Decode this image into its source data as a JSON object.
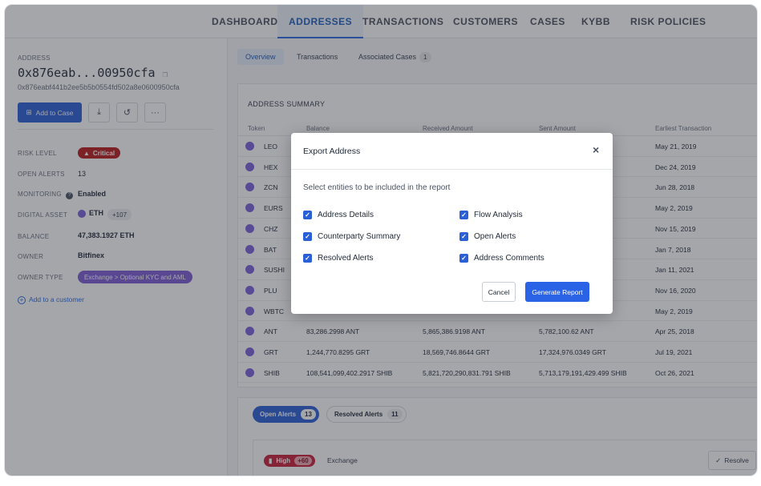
{
  "nav": {
    "items": [
      {
        "label": "DASHBOARD",
        "active": false
      },
      {
        "label": "ADDRESSES",
        "active": true
      },
      {
        "label": "TRANSACTIONS",
        "active": false
      },
      {
        "label": "CUSTOMERS",
        "active": false
      },
      {
        "label": "CASES",
        "active": false
      },
      {
        "label": "KYBB",
        "active": false
      },
      {
        "label": "RISK POLICIES",
        "active": false
      }
    ]
  },
  "address": {
    "section_label": "ADDRESS",
    "short_hash": "0x876eab...00950cfa",
    "full_hash": "0x876eabf441b2ee5b5b0554fd502a8e0600950cfa",
    "add_to_case_label": "Add to Case",
    "actions": {
      "download_icon": "download-icon",
      "history_icon": "history-icon",
      "more_label": "···"
    }
  },
  "details": {
    "risk_level_label": "RISK LEVEL",
    "risk_level_value": "Critical",
    "open_alerts_label": "OPEN ALERTS",
    "open_alerts_value": "13",
    "monitoring_label": "MONITORING",
    "monitoring_value": "Enabled",
    "digital_asset_label": "DIGITAL ASSET",
    "digital_asset_value": "ETH",
    "digital_asset_extra": "+107",
    "balance_label": "BALANCE",
    "balance_value": "47,383.1927 ETH",
    "owner_label": "OWNER",
    "owner_value": "Bitfinex",
    "owner_type_label": "OWNER TYPE",
    "owner_type_value": "Exchange > Optional KYC and AML",
    "add_customer_label": "Add to a customer"
  },
  "subtabs": [
    {
      "label": "Overview",
      "active": true
    },
    {
      "label": "Transactions",
      "active": false
    },
    {
      "label": "Associated Cases",
      "count": "1",
      "active": false
    }
  ],
  "summary": {
    "title": "ADDRESS SUMMARY",
    "columns": [
      "Token",
      "Balance",
      "Received Amount",
      "Sent Amount",
      "Earliest Transaction"
    ],
    "rows": [
      {
        "token": "LEO",
        "balance": "",
        "received": "",
        "sent": "",
        "earliest": "May 21, 2019"
      },
      {
        "token": "HEX",
        "balance": "",
        "received": "",
        "sent": "",
        "earliest": "Dec 24, 2019"
      },
      {
        "token": "ZCN",
        "balance": "",
        "received": "",
        "sent": "",
        "earliest": "Jun 28, 2018"
      },
      {
        "token": "EURS",
        "balance": "",
        "received": "",
        "sent": "",
        "earliest": "May 2, 2019"
      },
      {
        "token": "CHZ",
        "balance": "",
        "received": "",
        "sent": "",
        "earliest": "Nov 15, 2019"
      },
      {
        "token": "BAT",
        "balance": "",
        "received": "",
        "sent": "",
        "earliest": "Jan 7, 2018"
      },
      {
        "token": "SUSHI",
        "balance": "",
        "received": "",
        "sent": "",
        "earliest": "Jan 11, 2021"
      },
      {
        "token": "PLU",
        "balance": "",
        "received": "",
        "sent": "",
        "earliest": "Nov 16, 2020"
      },
      {
        "token": "WBTC",
        "balance": "",
        "received": "",
        "sent": "",
        "earliest": "May 2, 2019"
      },
      {
        "token": "ANT",
        "balance": "83,286.2998 ANT",
        "received": "5,865,386.9198 ANT",
        "sent": "5,782,100.62 ANT",
        "earliest": "Apr 25, 2018"
      },
      {
        "token": "GRT",
        "balance": "1,244,770.8295 GRT",
        "received": "18,569,746.8644 GRT",
        "sent": "17,324,976.0349 GRT",
        "earliest": "Jul 19, 2021"
      },
      {
        "token": "SHIB",
        "balance": "108,541,099,402.2917 SHIB",
        "received": "5,821,720,290,831.791 SHIB",
        "sent": "5,713,179,191,429.499 SHIB",
        "earliest": "Oct 26, 2021"
      }
    ]
  },
  "alerts": {
    "open_label": "Open Alerts",
    "open_count": "13",
    "resolved_label": "Resolved Alerts",
    "resolved_count": "11",
    "high_label": "High",
    "high_score": "+60",
    "category": "Exchange",
    "resolve_label": "Resolve"
  },
  "modal": {
    "title": "Export Address",
    "close_label": "×",
    "description": "Select entities to be included in the report",
    "options": [
      {
        "label": "Address Details",
        "checked": true
      },
      {
        "label": "Flow Analysis",
        "checked": true
      },
      {
        "label": "Counterparty Summary",
        "checked": true
      },
      {
        "label": "Open Alerts",
        "checked": true
      },
      {
        "label": "Resolved Alerts",
        "checked": true
      },
      {
        "label": "Address Comments",
        "checked": true
      }
    ],
    "cancel_label": "Cancel",
    "generate_label": "Generate Report"
  },
  "colors": {
    "accent": "#2a5fd6",
    "critical": "#b91c1c",
    "owner_type": "#7c5cd6",
    "token": "#7b61d9"
  }
}
